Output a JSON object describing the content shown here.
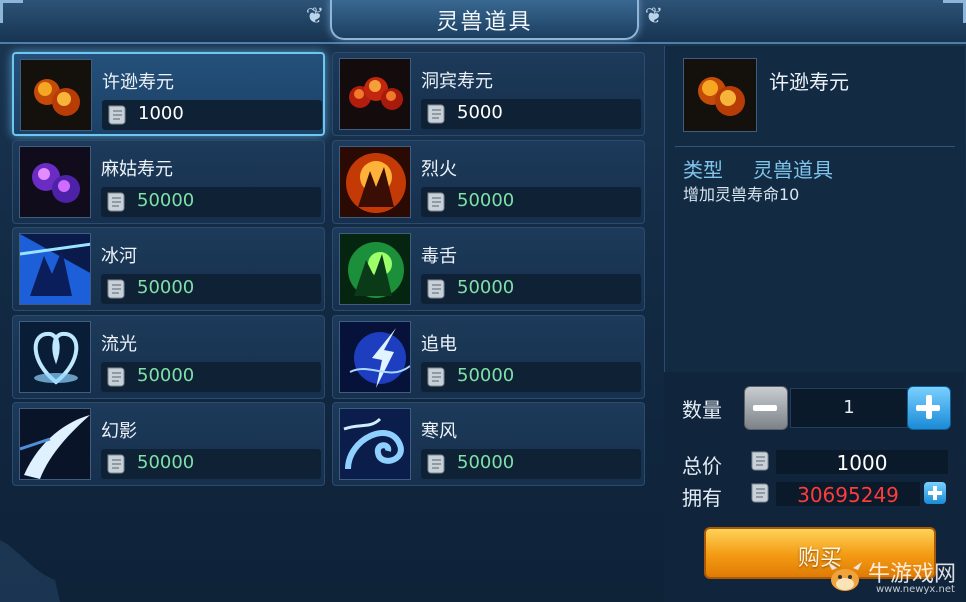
{
  "title": "灵兽道具",
  "colors": {
    "price_white": "#ffffff",
    "price_green": "#7fe0a8",
    "owned_red": "#ff3b3b"
  },
  "items": [
    {
      "name": "许逊寿元",
      "price": "1000",
      "icon": "fire-orbs-icon",
      "selected": true
    },
    {
      "name": "洞宾寿元",
      "price": "5000",
      "icon": "red-orbs-icon",
      "selected": false
    },
    {
      "name": "麻姑寿元",
      "price": "50000",
      "icon": "purple-orbs-icon",
      "selected": false
    },
    {
      "name": "烈火",
      "price": "50000",
      "icon": "fire-claw-icon",
      "selected": false
    },
    {
      "name": "冰河",
      "price": "50000",
      "icon": "ice-claw-icon",
      "selected": false
    },
    {
      "name": "毒舌",
      "price": "50000",
      "icon": "poison-claw-icon",
      "selected": false
    },
    {
      "name": "流光",
      "price": "50000",
      "icon": "flowing-light-icon",
      "selected": false
    },
    {
      "name": "追电",
      "price": "50000",
      "icon": "lightning-icon",
      "selected": false
    },
    {
      "name": "幻影",
      "price": "50000",
      "icon": "phantom-slash-icon",
      "selected": false
    },
    {
      "name": "寒风",
      "price": "50000",
      "icon": "cold-wind-icon",
      "selected": false
    }
  ],
  "detail": {
    "name": "许逊寿元",
    "type_label": "类型",
    "type_value": "灵兽道具",
    "description": "增加灵兽寿命10"
  },
  "purchase": {
    "quantity_label": "数量",
    "quantity": "1",
    "total_label": "总价",
    "total": "1000",
    "owned_label": "拥有",
    "owned": "30695249",
    "buy_label": "购买"
  },
  "watermark": {
    "main": "牛游戏网",
    "sub": "www.newyx.net"
  }
}
